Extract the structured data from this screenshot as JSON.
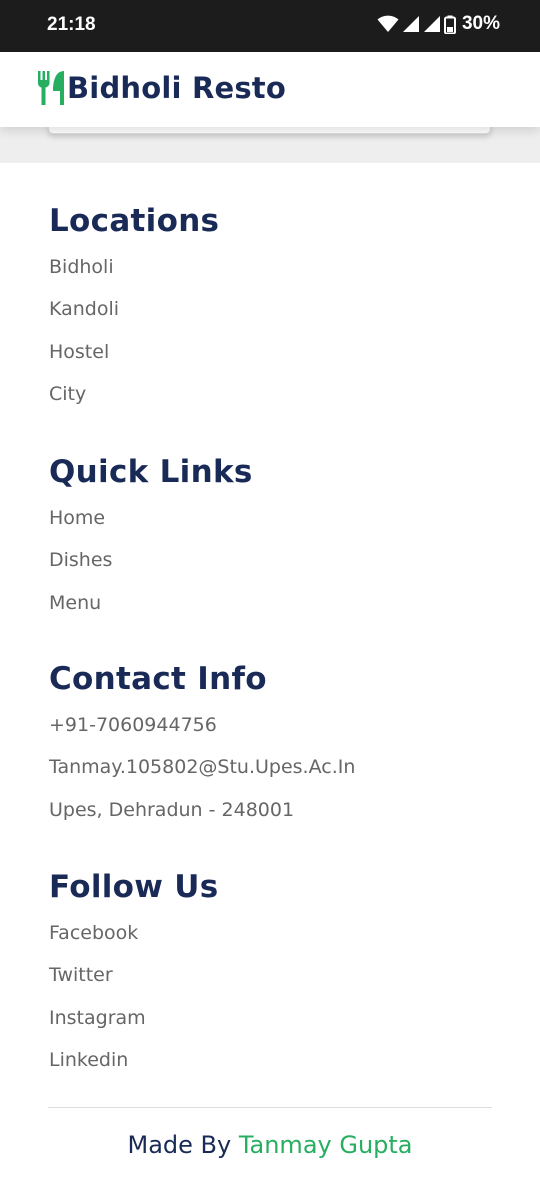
{
  "status_bar": {
    "time": "21:18",
    "battery": "30%"
  },
  "header": {
    "brand": "Bidholi Resto",
    "logo_icon": "utensils-icon",
    "accent_color": "#27ae60",
    "text_color": "#192a56"
  },
  "footer": {
    "sections": [
      {
        "title": "Locations",
        "links": [
          "Bidholi",
          "Kandoli",
          "Hostel",
          "City"
        ]
      },
      {
        "title": "Quick Links",
        "links": [
          "Home",
          "Dishes",
          "Menu"
        ]
      },
      {
        "title": "Contact Info",
        "links": [
          "+91-7060944756",
          "Tanmay.105802@Stu.Upes.Ac.In",
          "Upes, Dehradun - 248001"
        ]
      },
      {
        "title": "Follow Us",
        "links": [
          "Facebook",
          "Twitter",
          "Instagram",
          "Linkedin"
        ]
      }
    ],
    "credit_prefix": "Made By ",
    "credit_author": "Tanmay Gupta"
  }
}
